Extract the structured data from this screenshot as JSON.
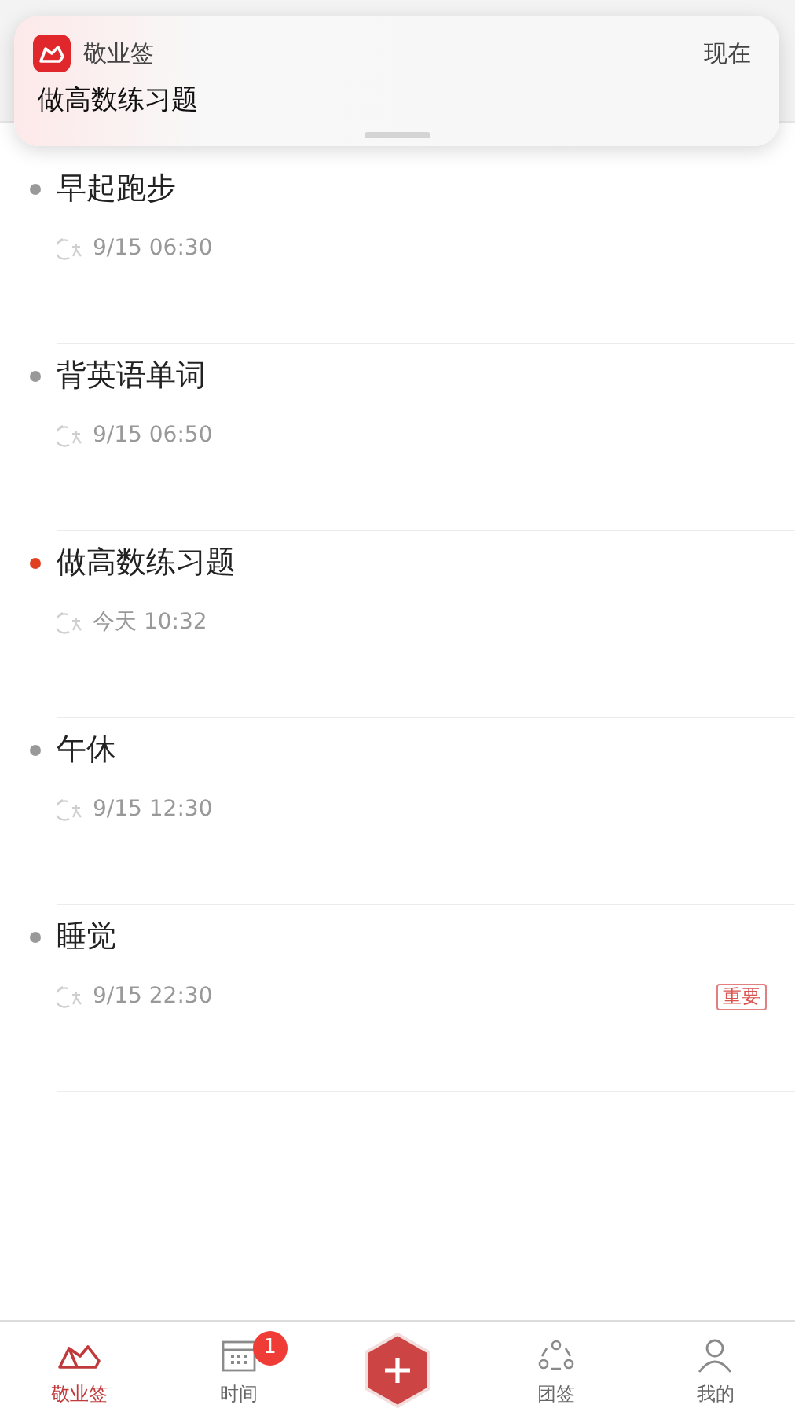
{
  "notification": {
    "app_name": "敬业签",
    "time": "现在",
    "message": "做高数练习题"
  },
  "reminders": [
    {
      "title": "早起跑步",
      "time": "9/15 06:30",
      "color": "#999999"
    },
    {
      "title": "背英语单词",
      "time": "9/15 06:50",
      "color": "#999999"
    },
    {
      "title": "做高数练习题",
      "time": "今天 10:32",
      "color": "#e0401f"
    },
    {
      "title": "午休",
      "time": "9/15 12:30",
      "color": "#999999"
    },
    {
      "title": "睡觉",
      "time": "9/15 22:30",
      "color": "#999999",
      "tag": "重要"
    }
  ],
  "tab_bar": [
    {
      "kind": "notes",
      "label": "敬业签",
      "selected": true
    },
    {
      "kind": "calendar",
      "label": "时间",
      "selected": false,
      "badge": "1"
    },
    {
      "kind": "add"
    },
    {
      "kind": "team",
      "label": "团签",
      "selected": false
    },
    {
      "kind": "profile",
      "label": "我的",
      "selected": false
    }
  ]
}
